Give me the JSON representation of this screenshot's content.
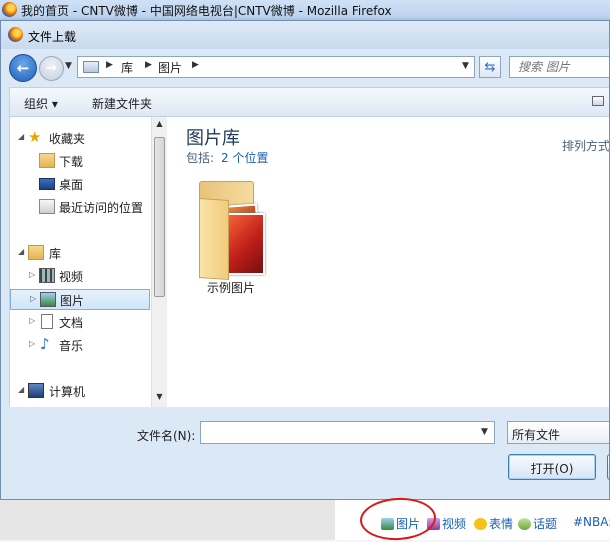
{
  "browser": {
    "title": "我的首页 - CNTV微博 - 中国网络电视台|CNTV微博 - Mozilla Firefox"
  },
  "dialog": {
    "title": "文件上载",
    "breadcrumb": [
      "库",
      "图片"
    ],
    "search_placeholder": "搜索 图片",
    "toolbar": {
      "organize": "组织 ▾",
      "new_folder": "新建文件夹"
    },
    "nav": {
      "favorites": "收藏夹",
      "downloads": "下载",
      "desktop": "桌面",
      "recent": "最近访问的位置",
      "libraries": "库",
      "videos": "视频",
      "pictures": "图片",
      "documents": "文档",
      "music": "音乐",
      "computer": "计算机"
    },
    "content": {
      "title": "图片库",
      "includes_label": "包括:",
      "includes_link": "2 个位置",
      "sort_label": "排列方式:",
      "folder_name": "示例图片"
    },
    "filename_label": "文件名(N):",
    "filename_value": "",
    "filter_value": "所有文件",
    "open_button": "打开(O)"
  },
  "page": {
    "tools": {
      "picture": "图片",
      "video": "视频",
      "emotion": "表情",
      "topic": "话题",
      "tag": "#NBA:"
    }
  },
  "colors": {
    "accent": "#1a5fb4",
    "annotation_circle": "#d41c1c",
    "title_blue": "#1e395b"
  }
}
